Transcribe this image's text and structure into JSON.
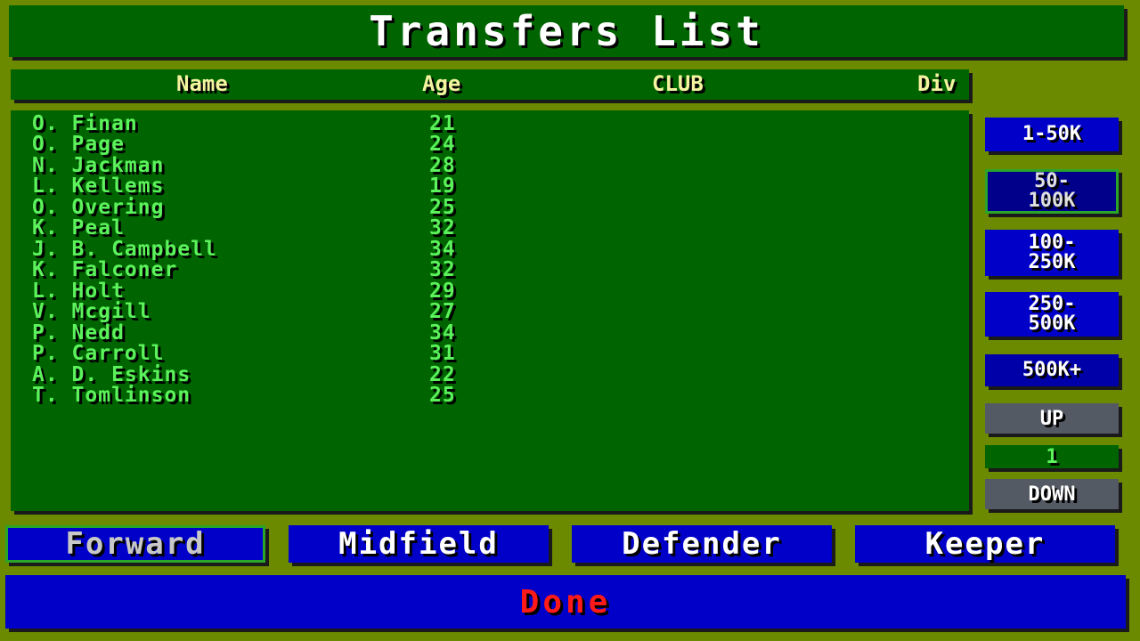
{
  "title": "Transfers List",
  "headers": {
    "name": "Name",
    "age": "Age",
    "club": "CLUB",
    "div": "Div"
  },
  "players": [
    {
      "name": "O. Finan",
      "age": "21"
    },
    {
      "name": "O. Page",
      "age": "24"
    },
    {
      "name": "N. Jackman",
      "age": "28"
    },
    {
      "name": "L. Kellems",
      "age": "19"
    },
    {
      "name": "O. Overing",
      "age": "25"
    },
    {
      "name": "K. Peal",
      "age": "32"
    },
    {
      "name": "J. B. Campbell",
      "age": "34"
    },
    {
      "name": "K. Falconer",
      "age": "32"
    },
    {
      "name": "L. Holt",
      "age": "29"
    },
    {
      "name": "V. Mcgill",
      "age": "27"
    },
    {
      "name": "P. Nedd",
      "age": "34"
    },
    {
      "name": "P. Carroll",
      "age": "31"
    },
    {
      "name": "A. D. Eskins",
      "age": "22"
    },
    {
      "name": "T. Tomlinson",
      "age": "25"
    }
  ],
  "price_filters": [
    {
      "line1": "1-50K",
      "line2": ""
    },
    {
      "line1": "50-",
      "line2": "100K"
    },
    {
      "line1": "100-",
      "line2": "250K"
    },
    {
      "line1": "250-",
      "line2": "500K"
    },
    {
      "line1": "500K+",
      "line2": ""
    }
  ],
  "pager": {
    "up": "UP",
    "page": "1",
    "down": "DOWN"
  },
  "positions": [
    "Forward",
    "Midfield",
    "Defender",
    "Keeper"
  ],
  "done": "Done",
  "colors": {
    "background": "#6b8a00",
    "panel": "#006400",
    "button": "#0000c8",
    "list_text": "#5cf25c",
    "header_text": "#f4f4a0",
    "done_text": "#ff1a1a"
  }
}
